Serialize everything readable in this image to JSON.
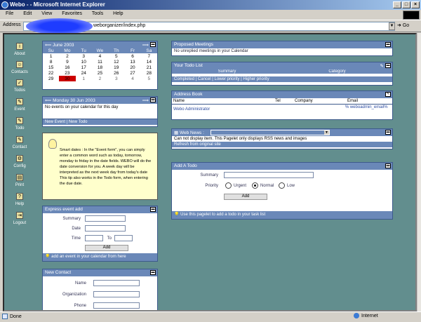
{
  "window": {
    "title": "Webo - - Microsoft Internet Explorer"
  },
  "menu": {
    "items": [
      "File",
      "Edit",
      "View",
      "Favorites",
      "Tools",
      "Help"
    ]
  },
  "address": {
    "label": "Address",
    "url": "weborganizer/index.php",
    "go_label": "Go"
  },
  "nav": {
    "items": [
      {
        "label": "About",
        "icon": "about-icon"
      },
      {
        "label": "Contacts",
        "icon": "contacts-icon"
      },
      {
        "label": "Todos",
        "icon": "todos-icon"
      },
      {
        "label": "Event",
        "icon": "event-icon"
      },
      {
        "label": "Todo",
        "icon": "todo-icon"
      },
      {
        "label": "Contact",
        "icon": "contact-icon"
      },
      {
        "label": "Config",
        "icon": "config-icon"
      },
      {
        "label": "Print",
        "icon": "print-icon"
      },
      {
        "label": "Help",
        "icon": "help-icon"
      },
      {
        "label": "Logout",
        "icon": "logout-icon"
      }
    ]
  },
  "calendar": {
    "title": "June 2003",
    "weekdays": [
      "Su",
      "Mo",
      "Tu",
      "We",
      "Th",
      "Fr",
      "Sa"
    ],
    "weeks": [
      [
        "1",
        "2",
        "3",
        "4",
        "5",
        "6",
        "7"
      ],
      [
        "8",
        "9",
        "10",
        "11",
        "12",
        "13",
        "14"
      ],
      [
        "15",
        "16",
        "17",
        "18",
        "19",
        "20",
        "21"
      ],
      [
        "22",
        "23",
        "24",
        "25",
        "26",
        "27",
        "28"
      ],
      [
        "29",
        "30",
        "1",
        "2",
        "3",
        "4",
        "5"
      ]
    ]
  },
  "day": {
    "title": "Monday 30 Jun 2003",
    "message": "No events on your calendar for this day",
    "footer": "New Event | New Todo"
  },
  "tip": {
    "text": "Smart dates : In the \"Event form\", you can simply enter a common word such as today, tomorrow, monday to friday in the date fields. WEBO will do the date conversion for you. A week day will be interpreted as the next week day from today's date This tip also works in the Todo form, when entering the due date."
  },
  "express": {
    "title": "Express event add",
    "summary_label": "Summary",
    "date_label": "Date",
    "time_label": "Time",
    "to_label": "To",
    "add_label": "Add",
    "footer": "add an event in your calendar from here"
  },
  "newcontact": {
    "title": "New Contact",
    "name_label": "Name",
    "org_label": "Organization",
    "phone_label": "Phone"
  },
  "meetings": {
    "title": "Proposed Meetings",
    "message": "No unreplied meetings in your Calendar"
  },
  "todolist": {
    "title": "Your Todo List",
    "col_summary": "Summary",
    "col_category": "Category",
    "footer": "Completed | Cancel | Lower priority | Higher priority"
  },
  "addressbook": {
    "title": "Address Book",
    "columns": [
      "Name",
      "Tel",
      "Company",
      "Email"
    ],
    "rows": [
      {
        "name": "Webo Administrator",
        "tel": "",
        "company": "",
        "email": "% weboadmin_email%"
      }
    ]
  },
  "webnews": {
    "title": "Web News :",
    "message": "Can not display item. This Pagelet only displays RSS news and images",
    "footer": "Refresh from original site"
  },
  "addtodo": {
    "title": "Add A Todo",
    "summary_label": "Summary",
    "priority_label": "Priority",
    "urgent": "Urgent",
    "normal": "Normal",
    "low": "Low",
    "add_label": "Add",
    "footer": "Use this pagelet to add a todo in your task list"
  },
  "status": {
    "left": "Done",
    "zone": "Internet"
  },
  "colors": {
    "bg": "#628e8e",
    "header": "#6a88b8",
    "today": "#cc0000"
  }
}
